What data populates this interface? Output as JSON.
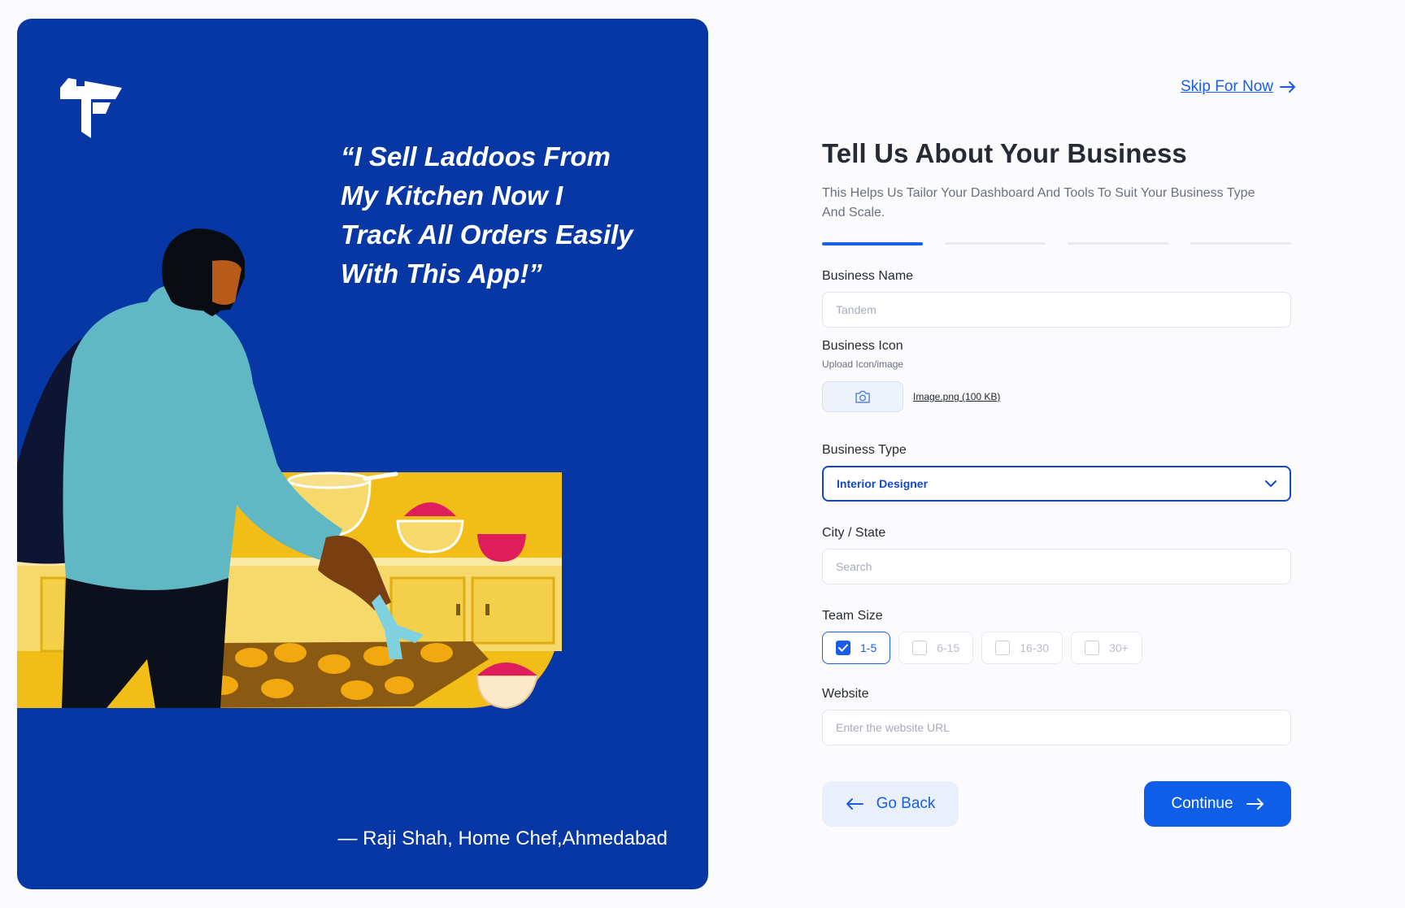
{
  "hero": {
    "quote_lines": [
      "“I Sell Laddoos From",
      "My Kitchen Now I",
      "Track All Orders Easily",
      "With This App!”"
    ],
    "attribution": "— Raji Shah, Home Chef,Ahmedabad"
  },
  "skip_label": "Skip For Now",
  "form": {
    "title": "Tell Us About Your Business",
    "subtitle": "This Helps Us Tailor Your Dashboard And Tools To Suit Your Business Type And Scale.",
    "steps": {
      "current": 1,
      "total": 4
    },
    "business_name": {
      "label": "Business Name",
      "placeholder": "Tandem"
    },
    "business_icon": {
      "label": "Business Icon",
      "sublabel": "Upload Icon/image",
      "file": "Image.png (100 KB)",
      "icon": "camera-icon"
    },
    "business_type": {
      "label": "Business Type",
      "value": "Interior Designer",
      "icon": "chevron-down-icon"
    },
    "city_state": {
      "label": "City / State",
      "placeholder": "Search"
    },
    "team_size": {
      "label": "Team Size",
      "options": [
        "1-5",
        "6-15",
        "16-30",
        "30+"
      ],
      "selected": "1-5"
    },
    "website": {
      "label": "Website",
      "placeholder": "Enter the website URL"
    }
  },
  "actions": {
    "back_label": "Go Back",
    "continue_label": "Continue"
  },
  "colors": {
    "brand_blue": "#0637a4",
    "accent": "#1a5de8",
    "kitchen_yellow": "#f2bd17",
    "shirt_teal": "#5fb8c4"
  }
}
